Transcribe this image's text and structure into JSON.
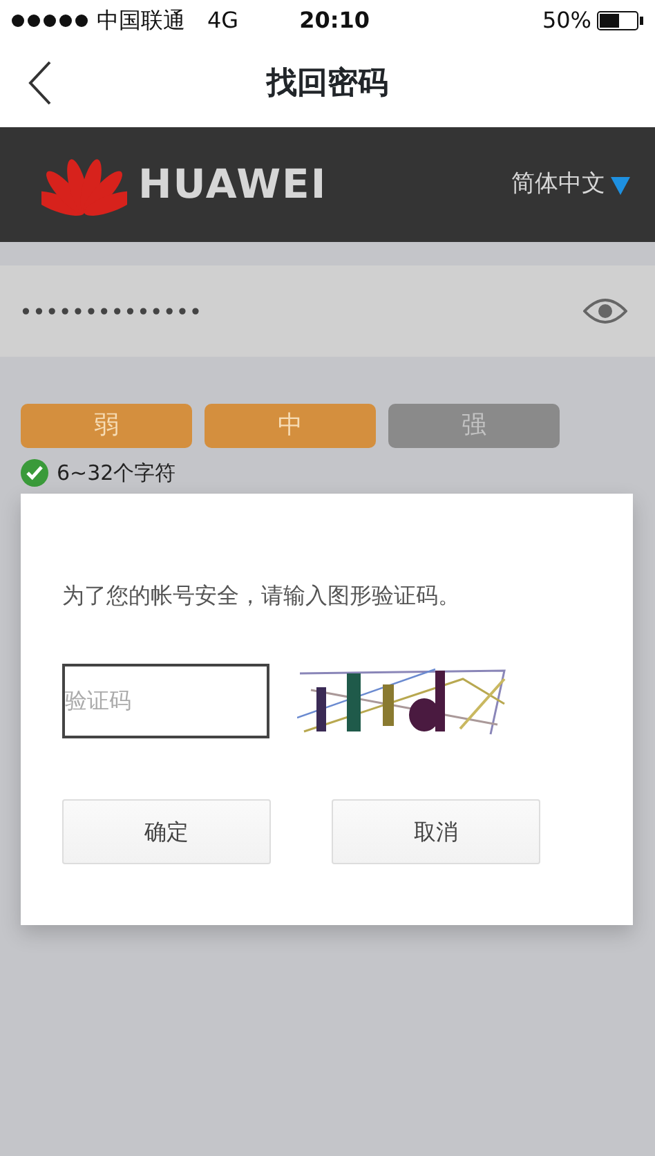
{
  "status_bar": {
    "carrier": "中国联通",
    "network": "4G",
    "time": "20:10",
    "battery": "50%"
  },
  "nav": {
    "title": "找回密码"
  },
  "header": {
    "brand": "HUAWEI",
    "language": "简体中文"
  },
  "password": {
    "value": "••••••••••••••"
  },
  "strength": [
    {
      "label": "弱",
      "on": true
    },
    {
      "label": "中",
      "on": true
    },
    {
      "label": "强",
      "on": false
    }
  ],
  "hint": {
    "text": "6~32个字符",
    "valid": true
  },
  "dialog": {
    "message": "为了您的帐号安全，请输入图形验证码。",
    "captcha": {
      "placeholder": "验证码",
      "kind": "picture"
    },
    "buttons": [
      {
        "label": "确定"
      },
      {
        "label": "取消"
      }
    ]
  }
}
